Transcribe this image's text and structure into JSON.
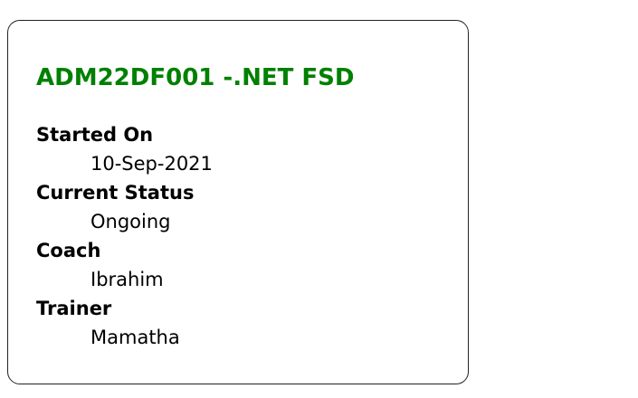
{
  "card": {
    "title": "ADM22DF001 -.NET FSD",
    "title_color": "#008000",
    "fields": [
      {
        "label": "Started On",
        "value": "10-Sep-2021"
      },
      {
        "label": "Current Status",
        "value": "Ongoing"
      },
      {
        "label": "Coach",
        "value": "Ibrahim"
      },
      {
        "label": "Trainer",
        "value": "Mamatha"
      }
    ]
  }
}
